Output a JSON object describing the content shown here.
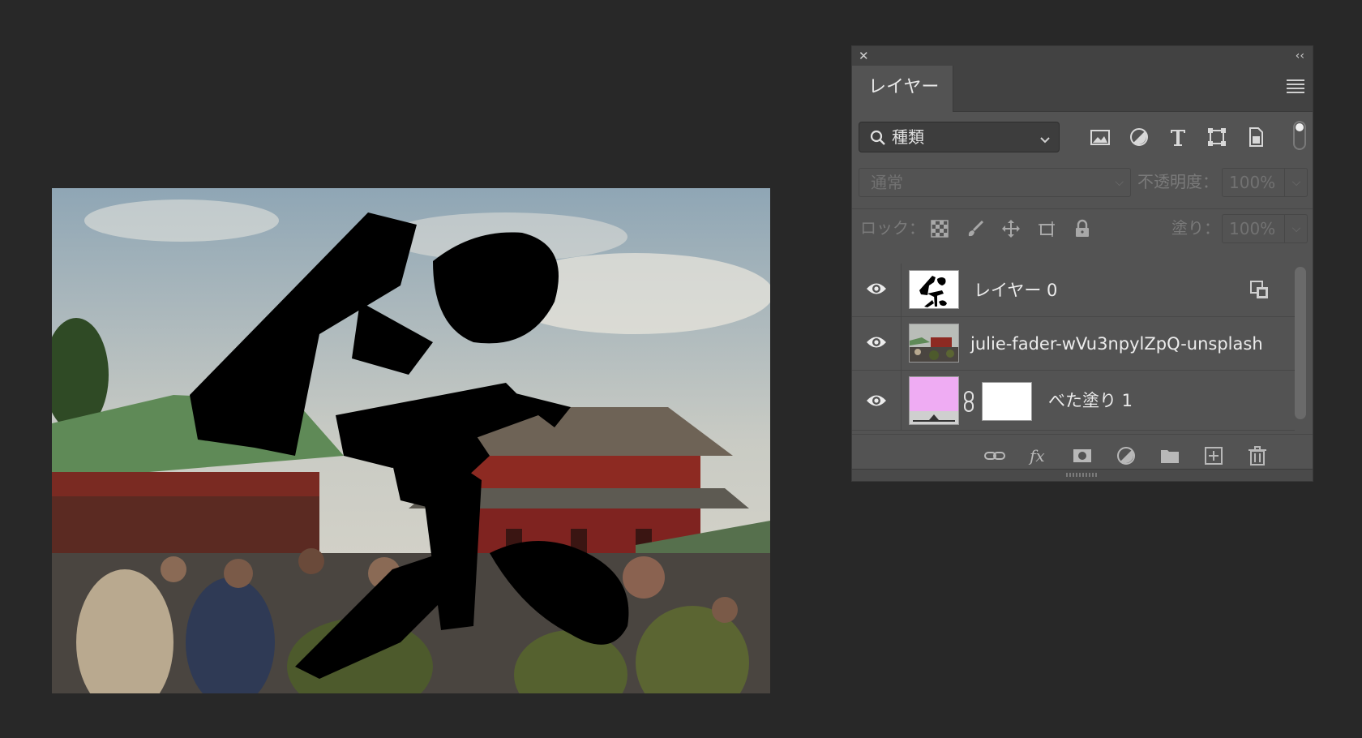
{
  "panel": {
    "close_glyph": "✕",
    "collapse_glyph": "‹‹",
    "tab_label": "レイヤー",
    "filter": {
      "selected": "種類"
    },
    "blend": {
      "mode": "通常",
      "opacity_label": "不透明度：",
      "opacity_value": "100%"
    },
    "lock": {
      "label": "ロック：",
      "fill_label": "塗り：",
      "fill_value": "100%"
    },
    "layers": [
      {
        "name": "レイヤー 0",
        "visible": true,
        "thumb": "kanji-matsuri"
      },
      {
        "name": "julie-fader-wVu3npylZpQ-unsplash",
        "visible": true,
        "thumb": "photo"
      },
      {
        "name": "べた塗り 1",
        "visible": true,
        "thumb": "fill",
        "fill_color": "#efacf3",
        "mask_color": "#ffffff"
      }
    ]
  },
  "icons": {
    "search": "search-icon",
    "filter_pixel": "image-icon",
    "filter_adjust": "adjustment-icon",
    "filter_type": "type-icon",
    "filter_shape": "shape-icon",
    "filter_smart": "smart-object-icon",
    "lock_pixels": "checkerboard-icon",
    "lock_paint": "brush-icon",
    "lock_position": "move-icon",
    "lock_artboard": "artboard-icon",
    "lock_all": "lock-icon",
    "link": "link-icon",
    "fx": "fx-icon",
    "mask": "mask-icon",
    "adjustment": "new-adjustment-icon",
    "group": "folder-icon",
    "new_layer": "new-layer-icon",
    "delete": "trash-icon"
  }
}
